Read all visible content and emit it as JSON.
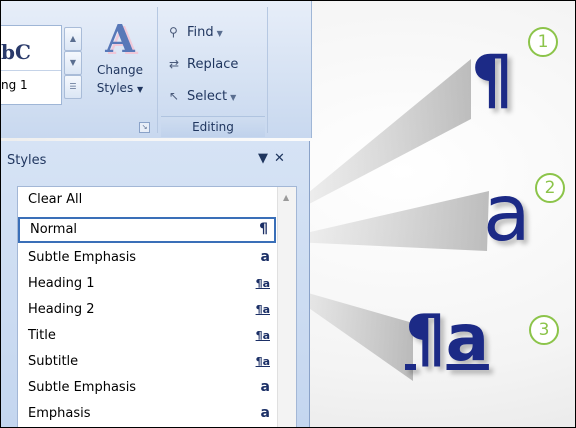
{
  "ribbon": {
    "style_preview_text": "bC",
    "style_preview_caption": "ng 1",
    "change_styles_glyph": "A",
    "change_styles_label_line1": "Change",
    "change_styles_label_line2": "Styles",
    "find_label": "Find",
    "replace_label": "Replace",
    "select_label": "Select",
    "editing_group_label": "Editing"
  },
  "pane": {
    "title": "Styles",
    "items": [
      {
        "label": "Clear All",
        "mark": ""
      },
      {
        "label": "Normal",
        "mark": "¶"
      },
      {
        "label": "Subtle Emphasis",
        "mark": "a"
      },
      {
        "label": "Heading 1",
        "mark": "¶a"
      },
      {
        "label": "Heading 2",
        "mark": "¶a"
      },
      {
        "label": "Title",
        "mark": "¶a"
      },
      {
        "label": "Subtitle",
        "mark": "¶a"
      },
      {
        "label": "Subtle Emphasis",
        "mark": "a"
      },
      {
        "label": "Emphasis",
        "mark": "a"
      }
    ]
  },
  "callouts": [
    {
      "number": "1",
      "glyph": "¶"
    },
    {
      "number": "2",
      "glyph": "a"
    },
    {
      "number": "3",
      "glyph": "¶a"
    }
  ],
  "colors": {
    "callout_ring": "#8cc44a",
    "style_mark": "#1c2a86",
    "ribbon": "#d6e2f3"
  }
}
